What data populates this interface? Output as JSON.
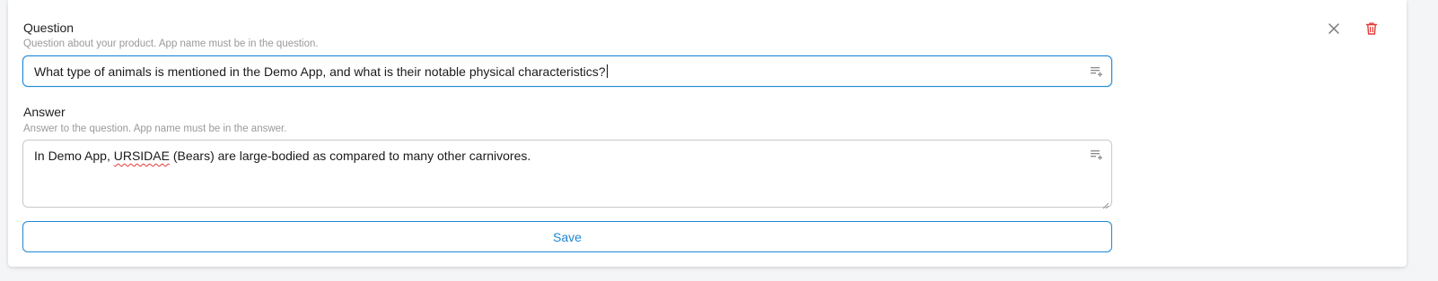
{
  "question": {
    "label": "Question",
    "hint": "Question about your product. App name must be in the question.",
    "value": "What type of animals is mentioned in the Demo App, and what is their notable physical characteristics?"
  },
  "answer": {
    "label": "Answer",
    "hint": "Answer to the question. App name must be in the answer.",
    "value_before": "In Demo App, ",
    "value_flagged": "URSIDAE",
    "value_after": " (Bears) are large-bodied as compared to many other carnivores."
  },
  "actions": {
    "save_label": "Save",
    "close_icon": "close-icon",
    "delete_icon": "trash-icon",
    "field_icon": "list-add-icon"
  },
  "colors": {
    "accent": "#1e88d6",
    "danger": "#e53935",
    "hint": "#9a9a9a"
  }
}
